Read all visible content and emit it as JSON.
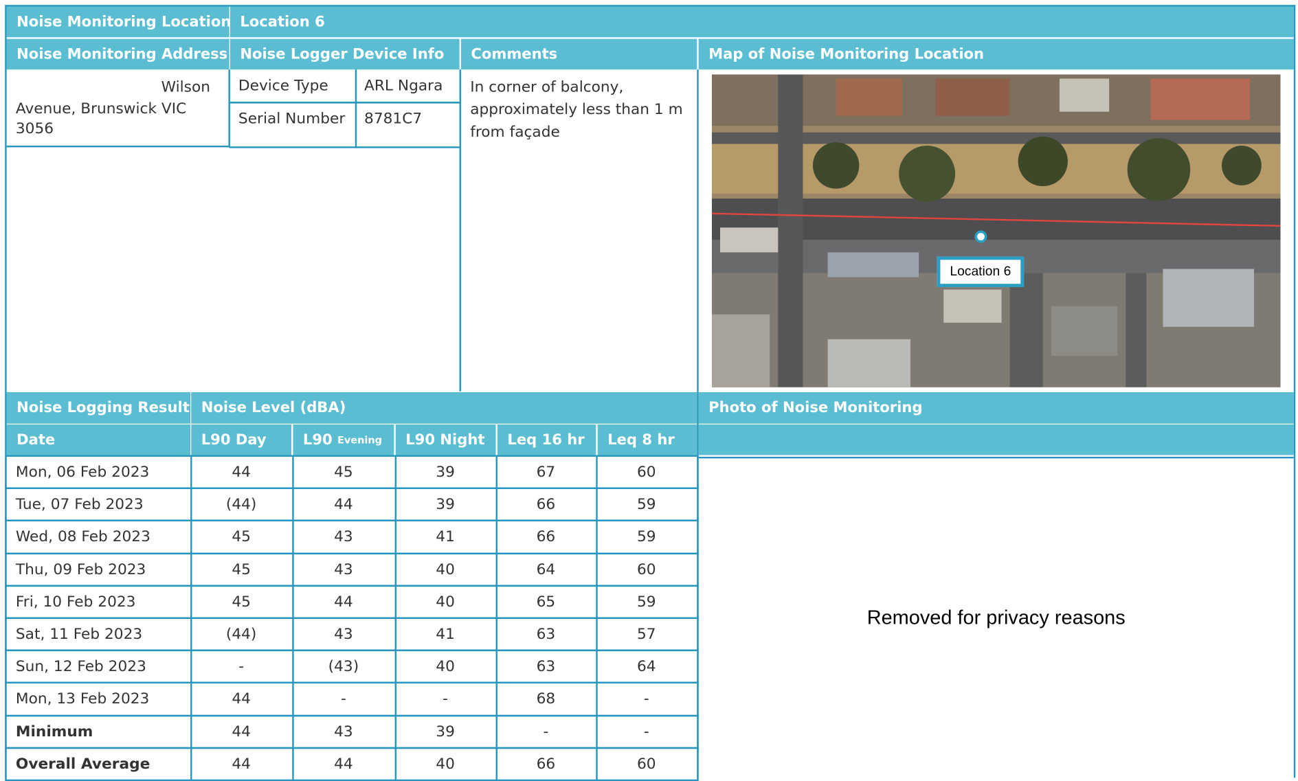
{
  "header": {
    "location_label": "Noise Monitoring Location",
    "location_value": "Location 6",
    "address_label": "Noise Monitoring Address",
    "device_label": "Noise Logger Device Info",
    "comments_label": "Comments",
    "map_label": "Map of Noise Monitoring Location"
  },
  "address": {
    "line1": "Wilson",
    "line2": "Avenue, Brunswick VIC",
    "line3": "3056"
  },
  "device": {
    "type_label": "Device Type",
    "type_value": "ARL Ngara",
    "serial_label": "Serial Number",
    "serial_value": "8781C7"
  },
  "comments": {
    "line1": "In corner of balcony,",
    "line2": "approximately less than 1 m",
    "line3": "from façade"
  },
  "map": {
    "marker_label": "Location 6"
  },
  "results": {
    "section_label": "Noise Logging Results",
    "level_label": "Noise Level (dBA)",
    "date_label": "Date",
    "columns": [
      {
        "main": "L90 Day",
        "sub": ""
      },
      {
        "main": "L90",
        "sub": "Evening"
      },
      {
        "main": "L90 Night",
        "sub": ""
      },
      {
        "main": "Leq 16 hr",
        "sub": ""
      },
      {
        "main": "Leq 8 hr",
        "sub": ""
      }
    ],
    "rows": [
      {
        "date": "Mon, 06 Feb 2023",
        "values": [
          "44",
          "45",
          "39",
          "67",
          "60"
        ]
      },
      {
        "date": "Tue, 07 Feb 2023",
        "values": [
          "(44)",
          "44",
          "39",
          "66",
          "59"
        ]
      },
      {
        "date": "Wed, 08 Feb 2023",
        "values": [
          "45",
          "43",
          "41",
          "66",
          "59"
        ]
      },
      {
        "date": "Thu, 09 Feb 2023",
        "values": [
          "45",
          "43",
          "40",
          "64",
          "60"
        ]
      },
      {
        "date": "Fri, 10 Feb 2023",
        "values": [
          "45",
          "44",
          "40",
          "65",
          "59"
        ]
      },
      {
        "date": "Sat, 11 Feb 2023",
        "values": [
          "(44)",
          "43",
          "41",
          "63",
          "57"
        ]
      },
      {
        "date": "Sun, 12 Feb 2023",
        "values": [
          "-",
          "(43)",
          "40",
          "63",
          "64"
        ]
      },
      {
        "date": "Mon, 13 Feb 2023",
        "values": [
          "44",
          "-",
          "-",
          "68",
          "-"
        ]
      },
      {
        "date": "Minimum",
        "values": [
          "44",
          "43",
          "39",
          "-",
          "-"
        ]
      },
      {
        "date": "Overall Average",
        "values": [
          "44",
          "44",
          "40",
          "66",
          "60"
        ]
      }
    ]
  },
  "photo": {
    "label": "Photo of Noise Monitoring",
    "removed_text": "Removed for privacy reasons"
  },
  "colors": {
    "header_bg": "#5bbdd1",
    "border": "#2496bf",
    "header_text": "#ffffff"
  }
}
